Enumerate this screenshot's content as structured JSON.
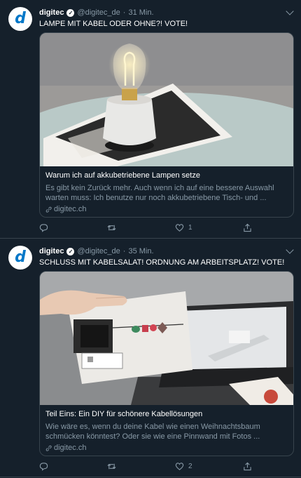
{
  "tweets": [
    {
      "author": "digitec",
      "handle": "@digitec_de",
      "dot": "·",
      "time": "31 Min.",
      "text": "LAMPE MIT KABEL ODER OHNE?! VOTE!",
      "avatar_letter": "d",
      "card": {
        "title": "Warum ich auf akkubetriebene Lampen setze",
        "description": "Es gibt kein Zurück mehr. Auch wenn ich auf eine bessere Auswahl warten muss: Ich benutze nur noch akkubetriebene Tisch- und ...",
        "link": "digitec.ch"
      },
      "actions": {
        "reply": "",
        "retweet": "",
        "like": "1",
        "share": ""
      }
    },
    {
      "author": "digitec",
      "handle": "@digitec_de",
      "dot": "·",
      "time": "35 Min.",
      "text": "SCHLUSS MIT KABELSALAT! ORDNUNG AM ARBEITSPLATZ! VOTE!",
      "avatar_letter": "d",
      "card": {
        "title": "Teil Eins: Ein DIY für schönere Kabellösungen",
        "description": "Wie wäre es, wenn du deine Kabel wie einen Weihnachtsbaum schmücken könntest? Oder sie wie eine Pinnwand mit Fotos ...",
        "link": "digitec.ch"
      },
      "actions": {
        "reply": "",
        "retweet": "",
        "like": "2",
        "share": ""
      }
    }
  ],
  "colors": {
    "background": "#15202b",
    "border": "#38444d",
    "secondary_text": "#8899a6",
    "brand_blue": "#0077c8"
  },
  "icons": [
    "verified-icon",
    "chevron-down-icon",
    "link-icon",
    "reply-icon",
    "retweet-icon",
    "like-icon",
    "share-icon"
  ]
}
